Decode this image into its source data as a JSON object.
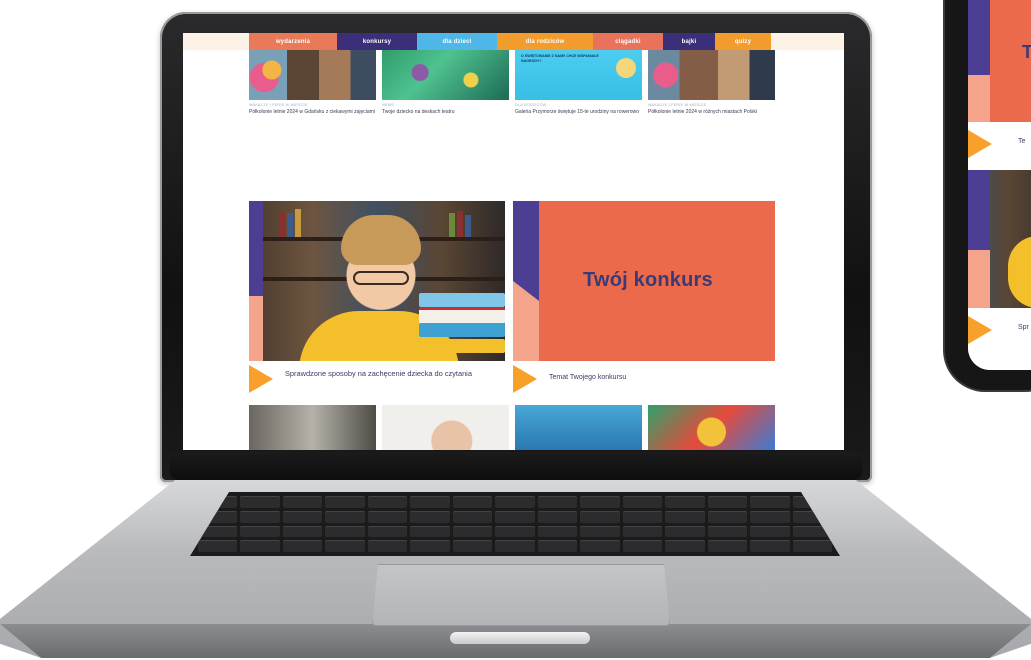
{
  "site": {
    "nav": [
      {
        "label": "wydarzenia",
        "color": "#e87a5a"
      },
      {
        "label": "konkursy",
        "color": "#3b2f7a"
      },
      {
        "label": "dla dzieci",
        "color": "#4fb6e8"
      },
      {
        "label": "dla rodziców",
        "color": "#f39c2e"
      },
      {
        "label": "ciągadki",
        "color": "#e8725a"
      },
      {
        "label": "bajki",
        "color": "#3b2f7a"
      },
      {
        "label": "quizy",
        "color": "#f39c2e"
      }
    ],
    "top_articles": [
      {
        "tag": "WAKACJE I FERIE W MIEŚCIE",
        "title": "Półkolonie letnie 2024 w Gdańsku z ciekawymi zajęciami"
      },
      {
        "tag": "NEWS",
        "title": "Twoje dziecko na deskach teatru"
      },
      {
        "tag": "DLA RODZICÓW",
        "title": "Galeria Przymorze świętuje 15-te urodziny na rowerowo"
      },
      {
        "tag": "WAKACJE I FERIE W MIEŚCIE",
        "title": "Półkolonie letnie 2024 w różnych miastach Polski"
      }
    ],
    "promo_text": "O ŚWIĘTOWANIE Z NAMI! CHCE WSPANIAŁE NAGRODY?",
    "feature_left": {
      "title": "Sprawdzone sposoby na zachęcenie dziecka do czytania"
    },
    "feature_right": {
      "panel_title": "Twój konkurs",
      "title": "Temat Twojego konkursu"
    }
  },
  "phone": {
    "big_letter": "T",
    "caption_1": "Te",
    "caption_2": "Spr"
  },
  "colors": {
    "orange": "#ec6a4c",
    "purple": "#4c3f93",
    "peach": "#f4a48a",
    "arrow": "#f7a02a"
  }
}
